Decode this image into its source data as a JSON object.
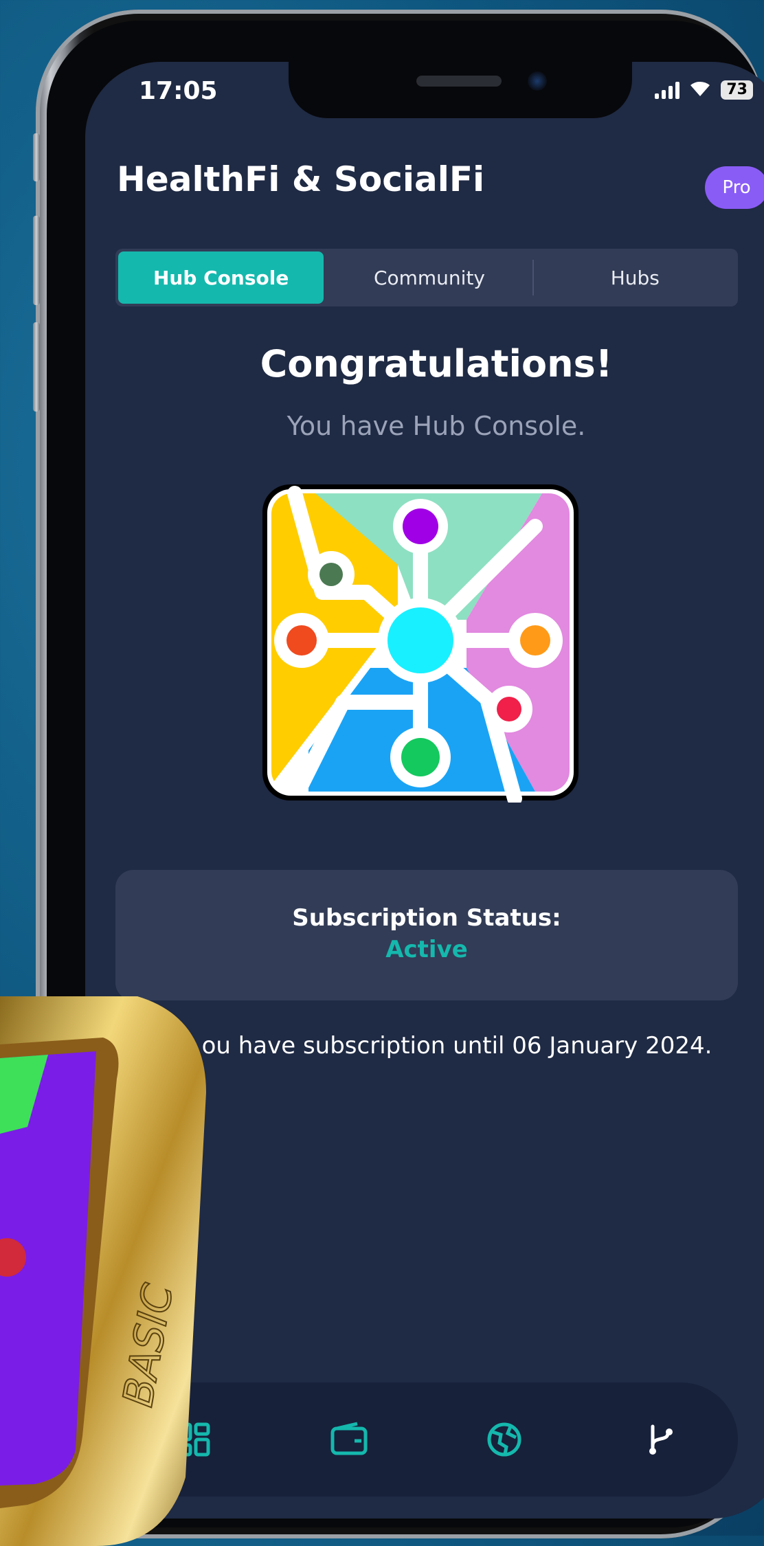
{
  "status_bar": {
    "time": "17:05",
    "battery": "73"
  },
  "header": {
    "title": "HealthFi & SocialFi",
    "badge": "Pro"
  },
  "tabs": [
    {
      "label": "Hub Console",
      "active": true
    },
    {
      "label": "Community",
      "active": false
    },
    {
      "label": "Hubs",
      "active": false
    }
  ],
  "hero": {
    "title": "Congratulations!",
    "subtitle": "You have Hub Console."
  },
  "subscription": {
    "label": "Subscription Status:",
    "value": "Active"
  },
  "until_text": "ou have subscription until 06 January 2024.",
  "bottom_nav": [
    "grid-icon",
    "wallet-icon",
    "globe-icon",
    "branch-icon"
  ],
  "medal": {
    "engraving": "BASIC"
  },
  "colors": {
    "accent": "#15b8ad",
    "badge": "#8a5cf6",
    "screen_bg": "#1f2a44",
    "card_bg": "#323c56"
  }
}
